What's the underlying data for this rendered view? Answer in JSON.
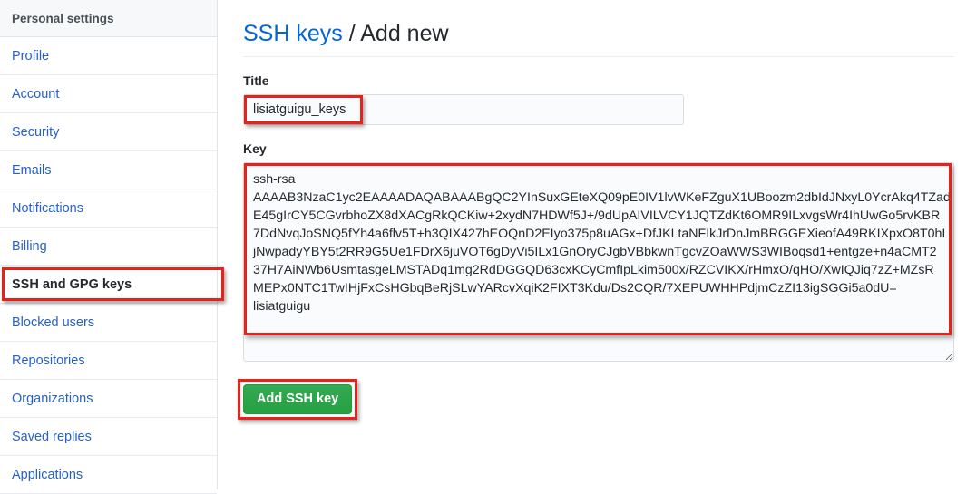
{
  "sidebar": {
    "header": "Personal settings",
    "items": [
      {
        "label": "Profile",
        "selected": false
      },
      {
        "label": "Account",
        "selected": false
      },
      {
        "label": "Security",
        "selected": false
      },
      {
        "label": "Emails",
        "selected": false
      },
      {
        "label": "Notifications",
        "selected": false
      },
      {
        "label": "Billing",
        "selected": false
      },
      {
        "label": "SSH and GPG keys",
        "selected": true
      },
      {
        "label": "Blocked users",
        "selected": false
      },
      {
        "label": "Repositories",
        "selected": false
      },
      {
        "label": "Organizations",
        "selected": false
      },
      {
        "label": "Saved replies",
        "selected": false
      },
      {
        "label": "Applications",
        "selected": false
      }
    ]
  },
  "header": {
    "breadcrumb_link": "SSH keys",
    "breadcrumb_separator": " / ",
    "breadcrumb_current": "Add new"
  },
  "form": {
    "title_label": "Title",
    "title_value": "lisiatguigu_keys",
    "title_placeholder": "",
    "key_label": "Key",
    "key_value": "ssh-rsa\nAAAAB3NzaC1yc2EAAAADAQABAAABgQC2YInSuxGEteXQ09pE0IV1lvWKeFZguX1UBoozm2dbIdJNxyL0YcrAkq4TZad\nE45gIrCY5CGvrbhoZX8dXACgRkQCKiw+2xydN7HDWf5J+/9dUpAIVILVCY1JQTZdKt6OMR9ILxvgsWr4IhUwGo5rvKBR\n7DdNvqJoSNQ5fYh4a6flv5T+h3QIX427hEOQnD2EIyo375p8uAGx+DfJKLtaNFIkJrDnJmBRGGEXieofA49RKIXpxO8T0hI\njNwpadyYBY5t2RR9G5Ue1FDrX6juVOT6gDyVi5ILx1GnOryCJgbVBbkwnTgcvZOaWWS3WIBoqsd1+entgze+n4aCMT2\n37H7AiNWb6UsmtasgeLMSTADq1mg2RdDGGQD63cxKCyCmfIpLkim500x/RZCVIKX/rHmxO/qHO/XwIQJiq7zZ+MZsR\nMEPx0NTC1TwIHjFxCsHGbqBeRjSLwYARcvXqiK2FIXT3Kdu/Ds2CQR/7XEPUWHHPdjmCzZI13igSGGi5a0dU=\nlisiatguigu",
    "key_placeholder": "",
    "submit_label": "Add SSH key"
  },
  "colors": {
    "link": "#0366d6",
    "highlight": "#e8211b",
    "submit_bg": "#2aa147",
    "sidebar_header_bg": "#f6f8fa"
  }
}
